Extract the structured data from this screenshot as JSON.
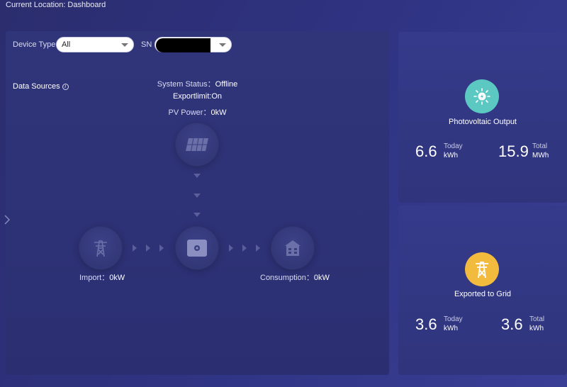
{
  "breadcrumb": "Current Location: Dashboard",
  "filters": {
    "device_type_label": "Device Type",
    "device_type_value": "All",
    "sn_label": "SN",
    "sn_value": ""
  },
  "data_sources_label": "Data Sources",
  "status": {
    "system_status_label": "System Status：",
    "system_status_value": "Offline",
    "exportlimit": "Exportlimit:On",
    "pv_power_label": "PV Power：",
    "pv_power_value": "0kW"
  },
  "flow": {
    "import_label": "Import：",
    "import_value": "0kW",
    "consumption_label": "Consumption：",
    "consumption_value": "0kW"
  },
  "pv_card": {
    "title": "Photovoltaic Output",
    "today_value": "6.6",
    "today_label": "Today",
    "today_unit": "kWh",
    "total_value": "15.9",
    "total_label": "Total",
    "total_unit": "MWh",
    "icon_color": "#5cc8c2"
  },
  "grid_card": {
    "title": "Exported to Grid",
    "today_value": "3.6",
    "today_label": "Today",
    "today_unit": "kWh",
    "total_value": "3.6",
    "total_label": "Total",
    "total_unit": "kWh",
    "icon_color": "#f2bb3d"
  },
  "icons": {
    "solar": "solar-panel-icon",
    "tower": "transmission-tower-icon",
    "inverter": "inverter-icon",
    "house": "house-icon",
    "sun": "sun-icon",
    "grid": "grid-tower-icon",
    "info": "info-icon",
    "chevron": "chevron-down-icon",
    "expand": "chevron-right-icon"
  }
}
